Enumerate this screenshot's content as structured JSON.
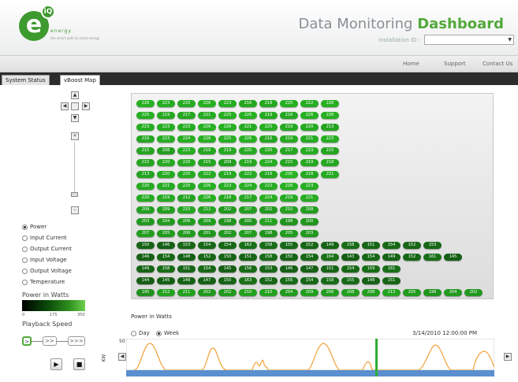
{
  "header": {
    "logo_letter": "e",
    "logo_iq": "iQ",
    "logo_subtitle": "energy",
    "logo_tagline": "the smart path to rated energy",
    "title_part1": "Data Monitoring",
    "title_part2": "Dashboard",
    "installation_label": "Installation ID :",
    "installation_value": ""
  },
  "nav": {
    "home": "Home",
    "support": "Support",
    "contact": "Contact Us"
  },
  "tabs": {
    "system_status": "System Status",
    "vboost_map": "vBoost Map"
  },
  "controls": {
    "radios": [
      {
        "label": "Power",
        "selected": true
      },
      {
        "label": "Input Current",
        "selected": false
      },
      {
        "label": "Output Current",
        "selected": false
      },
      {
        "label": "Input Voltage",
        "selected": false
      },
      {
        "label": "Output Voltage",
        "selected": false
      },
      {
        "label": "Temperature",
        "selected": false
      }
    ],
    "legend_title": "Power in Watts",
    "legend_min": "0",
    "legend_mid": "175",
    "legend_max": "350",
    "playback_label": "Playback Speed",
    "speeds": [
      ">",
      ">>",
      ">>>"
    ]
  },
  "map": {
    "rows": [
      [
        226,
        223,
        220,
        226,
        223,
        216,
        219,
        225,
        222,
        226
      ],
      [
        225,
        219,
        217,
        221,
        225,
        226,
        219,
        216,
        226,
        226
      ],
      [
        223,
        223,
        223,
        226,
        226,
        221,
        225,
        219,
        220,
        213
      ],
      [
        216,
        223,
        224,
        226,
        225,
        226,
        216,
        219,
        221,
        223
      ],
      [
        215,
        208,
        223,
        216,
        219,
        220,
        220,
        217,
        223,
        215
      ],
      [
        215,
        220,
        220,
        215,
        209,
        219,
        224,
        215,
        219,
        218
      ],
      [
        213,
        220,
        220,
        222,
        219,
        222,
        216,
        230,
        218,
        221
      ],
      [
        220,
        221,
        220,
        226,
        223,
        224,
        222,
        226,
        223
      ],
      [
        220,
        219,
        212,
        226,
        218,
        217,
        224,
        219,
        221
      ],
      [
        209,
        209,
        215,
        212,
        202,
        207,
        202,
        210,
        208
      ],
      [
        203,
        204,
        206,
        209,
        198,
        200,
        211,
        198,
        200
      ],
      [
        207,
        205,
        206,
        201,
        202,
        207,
        198,
        205,
        203
      ],
      [
        150,
        146,
        153,
        154,
        154,
        162,
        158,
        155,
        152,
        149,
        158,
        151,
        154,
        152,
        153
      ],
      [
        146,
        154,
        148,
        152,
        150,
        151,
        158,
        150,
        154,
        164,
        143,
        154,
        149,
        152,
        161,
        145
      ],
      [
        149,
        158,
        151,
        154,
        145,
        156,
        153,
        146,
        147,
        151,
        154,
        159,
        161
      ],
      [
        144,
        145,
        148,
        147,
        150,
        163,
        152,
        156,
        154,
        158,
        155,
        148,
        151
      ],
      [
        195,
        212,
        211,
        202,
        202,
        210,
        210,
        204,
        209,
        206,
        208,
        208,
        213,
        205,
        198,
        204,
        202
      ]
    ]
  },
  "chart": {
    "caption": "Power in Watts",
    "day_label": "Day",
    "week_label": "Week",
    "selected": "Week",
    "datetime": "3/14/2010 12:00:00 PM",
    "y_tick": "50",
    "y_label": "KW"
  }
}
